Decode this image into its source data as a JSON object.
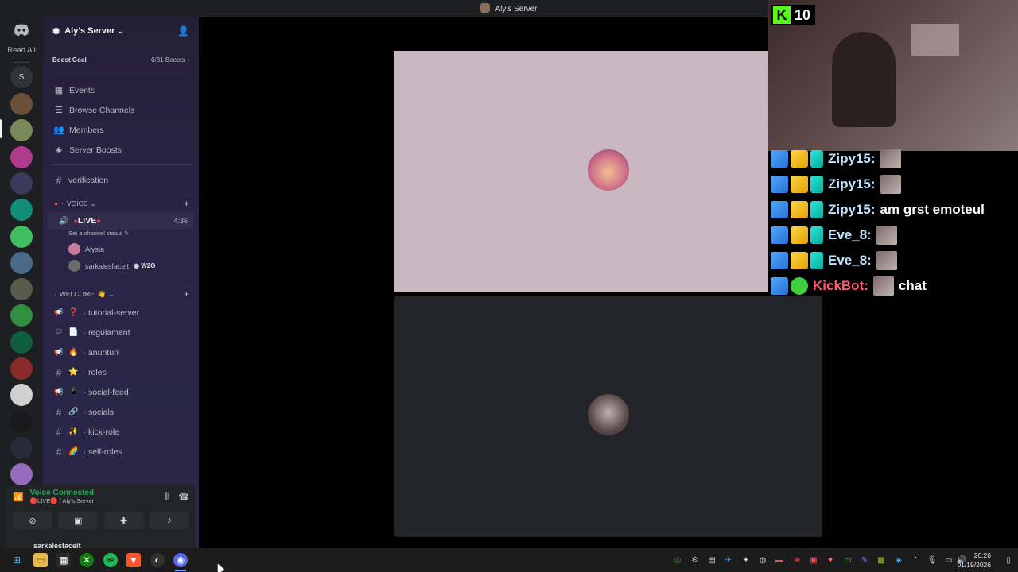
{
  "window": {
    "title": "Aly's Server"
  },
  "rail": {
    "read_all": "Read All",
    "letter_server": "S",
    "servers": [
      {
        "name": "server-1",
        "color": "#6b4f3a"
      },
      {
        "name": "server-2",
        "color": "#7a8a5a"
      },
      {
        "name": "server-3",
        "color": "#b03a8c"
      },
      {
        "name": "server-4",
        "color": "#3a3a5a"
      },
      {
        "name": "server-5",
        "color": "#0f8f7a"
      },
      {
        "name": "server-6",
        "color": "#3fbf5f"
      },
      {
        "name": "server-7",
        "color": "#4a6a8a"
      },
      {
        "name": "server-8",
        "color": "#5a5a4a"
      },
      {
        "name": "server-9",
        "color": "#2f8f3f"
      },
      {
        "name": "server-10",
        "color": "#0f5f3f"
      },
      {
        "name": "server-11",
        "color": "#8a2a2a"
      },
      {
        "name": "server-12",
        "color": "#d0d0d0"
      },
      {
        "name": "server-13",
        "color": "#1a1a1a"
      },
      {
        "name": "server-14",
        "color": "#2a2a3a"
      },
      {
        "name": "server-15",
        "color": "#9a6ac0"
      }
    ]
  },
  "sidebar": {
    "server_name": "Aly's Server",
    "boost_goal": "Boost Goal",
    "boost_count": "0/31 Boosts",
    "menu": [
      {
        "label": "Events",
        "icon": "calendar-icon"
      },
      {
        "label": "Browse Channels",
        "icon": "browse-icon"
      },
      {
        "label": "Members",
        "icon": "members-icon"
      },
      {
        "label": "Server Boosts",
        "icon": "boost-icon"
      }
    ],
    "verification": "verification",
    "voice_category": "VOICE",
    "live_channel": "LIVE",
    "live_time": "4:36",
    "channel_status": "Set a channel status",
    "voice_users": [
      {
        "name": "Alysia",
        "tag": ""
      },
      {
        "name": "sarkalesfaceit",
        "tag": "W2G"
      }
    ],
    "welcome_category": "WELCOME",
    "channels": [
      {
        "name": "tutorial-server",
        "emoji": "❓",
        "type": "announce"
      },
      {
        "name": "regulament",
        "emoji": "📄",
        "type": "rules"
      },
      {
        "name": "anunturi",
        "emoji": "🔥",
        "type": "announce"
      },
      {
        "name": "roles",
        "emoji": "⭐",
        "type": "text"
      },
      {
        "name": "social-feed",
        "emoji": "📱",
        "type": "announce"
      },
      {
        "name": "socials",
        "emoji": "🔗",
        "type": "text"
      },
      {
        "name": "kick-role",
        "emoji": "✨",
        "type": "text"
      },
      {
        "name": "self-roles",
        "emoji": "🌈",
        "type": "text"
      }
    ]
  },
  "voice_panel": {
    "title": "Voice Connected",
    "subtitle": "🔴LIVE🔴 / Aly's Server",
    "username": "sarkalesfaceit"
  },
  "overlay": {
    "kick_count": "10",
    "chat": [
      {
        "user": "Zipy15:",
        "msg": "",
        "color": "#bfe3ff",
        "emote": true,
        "bot": false
      },
      {
        "user": "Zipy15:",
        "msg": "",
        "color": "#bfe3ff",
        "emote": true,
        "bot": false
      },
      {
        "user": "Zipy15:",
        "msg": "am grst emoteul",
        "color": "#bfe3ff",
        "emote": false,
        "bot": false
      },
      {
        "user": "Eve_8:",
        "msg": "",
        "color": "#bfe3ff",
        "emote": true,
        "bot": false
      },
      {
        "user": "Eve_8:",
        "msg": "",
        "color": "#bfe3ff",
        "emote": true,
        "bot": false
      },
      {
        "user": "KickBot:",
        "msg": "chat",
        "color": "#ff5a6a",
        "emote": true,
        "bot": true
      }
    ]
  },
  "taskbar": {
    "time": "20:26",
    "date": "01/19/2026"
  },
  "colors": {
    "accent_green": "#23a55a",
    "kick_green": "#53fc18",
    "live_red": "#f23f43"
  }
}
